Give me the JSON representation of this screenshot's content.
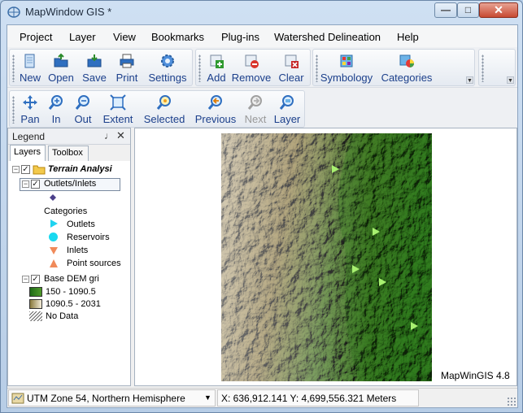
{
  "window": {
    "title": "MapWindow GIS *"
  },
  "menu": [
    "Project",
    "Layer",
    "View",
    "Bookmarks",
    "Plug-ins",
    "Watershed Delineation",
    "Help"
  ],
  "toolbar_file": {
    "new": "New",
    "open": "Open",
    "save": "Save",
    "print": "Print",
    "settings": "Settings"
  },
  "toolbar_layer": {
    "add": "Add",
    "remove": "Remove",
    "clear": "Clear"
  },
  "toolbar_symbology": {
    "symbology": "Symbology",
    "categories": "Categories"
  },
  "toolbar_nav": {
    "pan": "Pan",
    "in": "In",
    "out": "Out",
    "extent": "Extent",
    "selected": "Selected",
    "previous": "Previous",
    "next": "Next",
    "layer": "Layer"
  },
  "legend": {
    "title": "Legend",
    "pin": "♩",
    "close": "✕",
    "tabs": [
      "Layers",
      "Toolbox"
    ],
    "group": "Terrain Analysi",
    "layer1": {
      "name": "Outlets/Inlets",
      "categories_label": "Categories",
      "categories": [
        "Outlets",
        "Reservoirs",
        "Inlets",
        "Point sources"
      ]
    },
    "layer2": {
      "name": "Base DEM gri",
      "classes": [
        "150 - 1090.5",
        "1090.5 - 2031"
      ],
      "nodata": "No Data"
    }
  },
  "map": {
    "watermark": "MapWinGIS 4.8",
    "marker_color": "#a8f070"
  },
  "status": {
    "projection": "UTM Zone 54, Northern Hemisphere",
    "coordinates": "X: 636,912.141 Y: 4,699,556.321 Meters"
  },
  "colors": {
    "link_blue": "#1b3f8b",
    "dem_low": "#2f7a1e",
    "dem_high": "#f4f0e6"
  }
}
